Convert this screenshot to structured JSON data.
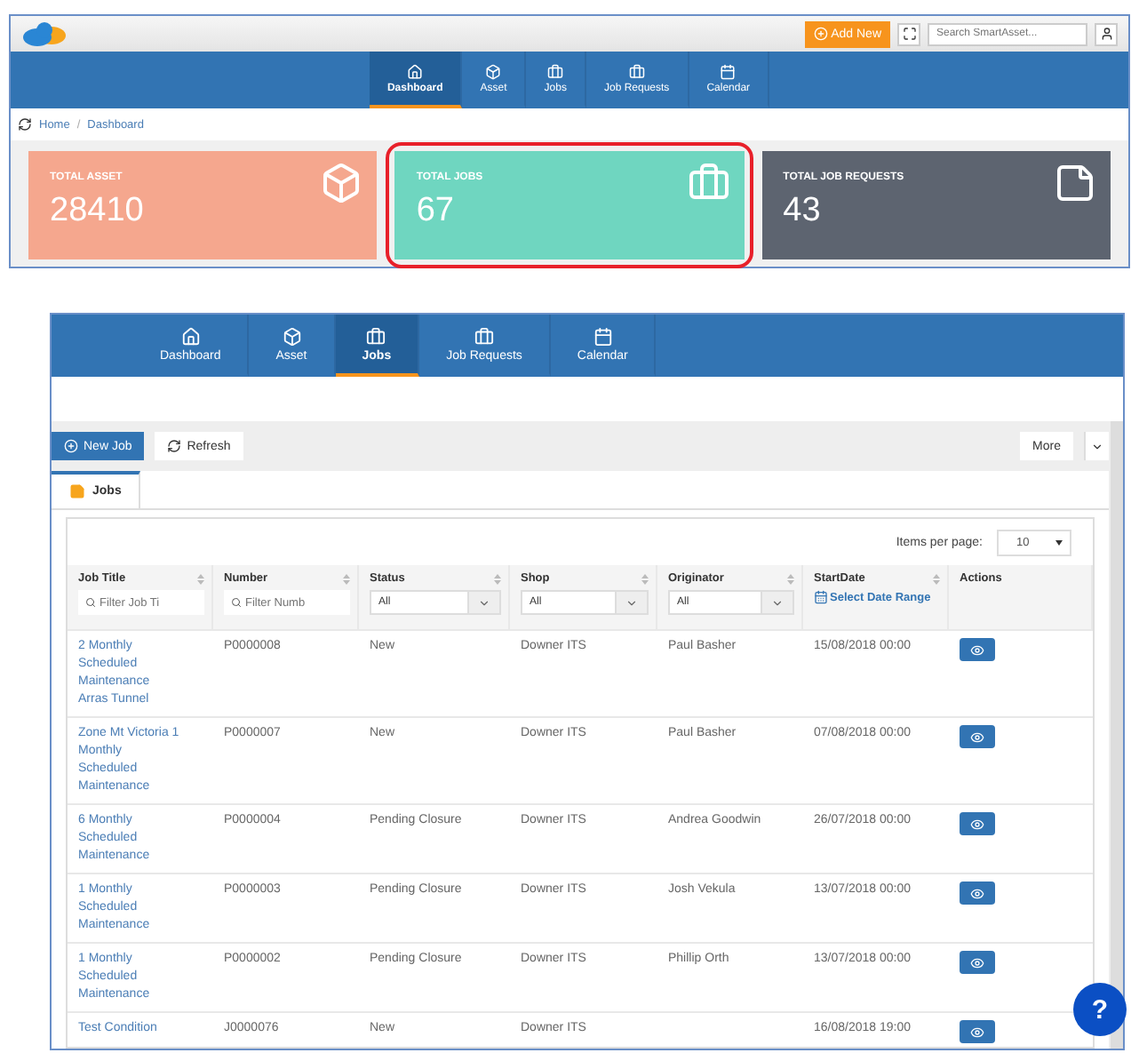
{
  "top_screen": {
    "header": {
      "add_button": "Add New",
      "search": {
        "placeholder": "Search SmartAsset..."
      }
    },
    "nav": [
      {
        "label": "Dashboard",
        "selected": true
      },
      {
        "label": "Asset",
        "selected": false
      },
      {
        "label": "Jobs",
        "selected": false
      },
      {
        "label": "Job Requests",
        "selected": false
      },
      {
        "label": "Calendar",
        "selected": false
      }
    ],
    "breadcrumb": {
      "items": [
        "Home",
        "Dashboard"
      ],
      "separator": "/"
    },
    "cards": [
      {
        "title": "TOTAL ASSET",
        "value": "28410",
        "color": "#f5a78e",
        "highlighted": false
      },
      {
        "title": "TOTAL JOBS",
        "value": "67",
        "color": "#6fd6c0",
        "highlighted": true
      },
      {
        "title": "TOTAL JOB REQUESTS",
        "value": "43",
        "color": "#5d6470",
        "highlighted": false
      }
    ]
  },
  "jobs_screen": {
    "nav": [
      {
        "label": "Dashboard",
        "selected": false
      },
      {
        "label": "Asset",
        "selected": false
      },
      {
        "label": "Jobs",
        "selected": true
      },
      {
        "label": "Job Requests",
        "selected": false
      },
      {
        "label": "Calendar",
        "selected": false
      }
    ],
    "toolbar": {
      "new_button": "New Job",
      "refresh_button": "Refresh",
      "more_button": "More"
    },
    "tabs": [
      {
        "label": "Jobs",
        "selected": true
      }
    ],
    "items_per_page": {
      "label": "Items per page:",
      "value": "10"
    },
    "table": {
      "columns": [
        {
          "label": "Job Title",
          "filter": {
            "kind": "text",
            "placeholder": "Filter Job Ti"
          }
        },
        {
          "label": "Number",
          "filter": {
            "kind": "text",
            "placeholder": "Filter Numb"
          }
        },
        {
          "label": "Status",
          "filter": {
            "kind": "select",
            "value": "All"
          }
        },
        {
          "label": "Shop",
          "filter": {
            "kind": "select",
            "value": "All"
          }
        },
        {
          "label": "Originator",
          "filter": {
            "kind": "select",
            "value": "All"
          }
        },
        {
          "label": "StartDate",
          "filter": {
            "kind": "date",
            "label": "Select Date Range"
          }
        },
        {
          "label": "Actions"
        }
      ],
      "rows": [
        {
          "cells": [
            "2 Monthly Scheduled Maintenance Arras Tunnel",
            "P0000008",
            "New",
            "Downer ITS",
            "Paul Basher",
            "15/08/2018 00:00"
          ]
        },
        {
          "cells": [
            "Zone Mt Victoria 1 Monthly Scheduled Maintenance",
            "P0000007",
            "New",
            "Downer ITS",
            "Paul Basher",
            "07/08/2018 00:00"
          ]
        },
        {
          "cells": [
            "6 Monthly Scheduled Maintenance",
            "P0000004",
            "Pending Closure",
            "Downer ITS",
            "Andrea Goodwin",
            "26/07/2018 00:00"
          ]
        },
        {
          "cells": [
            "1 Monthly Scheduled Maintenance",
            "P0000003",
            "Pending Closure",
            "Downer ITS",
            "Josh Vekula",
            "13/07/2018 00:00"
          ]
        },
        {
          "cells": [
            "1 Monthly Scheduled Maintenance",
            "P0000002",
            "Pending Closure",
            "Downer ITS",
            "Phillip Orth",
            "13/07/2018 00:00"
          ]
        },
        {
          "cells": [
            "Test Condition",
            "J0000076",
            "New",
            "Downer ITS",
            "",
            "16/08/2018 19:00"
          ]
        }
      ]
    }
  },
  "help_button": "?"
}
